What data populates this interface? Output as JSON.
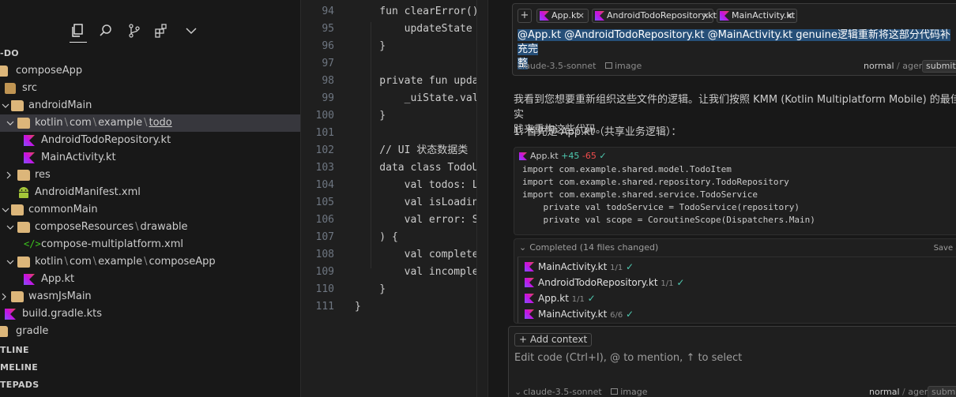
{
  "colors": {
    "accent": "#0078d4",
    "kotlin_a": "#7f52ff",
    "kotlin_b": "#e44857",
    "folder": "#dcb67a",
    "xml_green": "#3dc41e",
    "android_green": "#a4c639"
  },
  "explorer": {
    "toolbar_icons": [
      "files-icon",
      "search-icon",
      "source-control-icon",
      "extensions-icon",
      "chevron-down-icon"
    ],
    "root_label": "-DO",
    "tree": {
      "composeApp": "composeApp",
      "src": "src",
      "androidMain": "androidMain",
      "kotlin": "kotlin",
      "com": "com",
      "example": "example",
      "todo": "todo",
      "android_repo": "AndroidTodoRepository.kt",
      "main_activity": "MainActivity.kt",
      "res": "res",
      "manifest": "AndroidManifest.xml",
      "commonMain": "commonMain",
      "composeResources": "composeResources",
      "drawable": "drawable",
      "compose_xml": "compose-multiplatform.xml",
      "composeAppPkg": "composeApp",
      "app_kt": "App.kt",
      "wasmJsMain": "wasmJsMain",
      "build_gradle": "build.gradle.kts",
      "gradle": "gradle"
    },
    "path_sep": "\\",
    "sections": [
      "TLINE",
      "MELINE",
      "TEPADS"
    ]
  },
  "editor": {
    "lines": [
      {
        "n": "94",
        "code": "    fun clearError() {"
      },
      {
        "n": "95",
        "code": "        updateState { it"
      },
      {
        "n": "96",
        "code": "    }"
      },
      {
        "n": "97",
        "code": ""
      },
      {
        "n": "98",
        "code": "    private fun updateSt"
      },
      {
        "n": "99",
        "code": "        _uiState.value ="
      },
      {
        "n": "100",
        "code": "    }"
      },
      {
        "n": "101",
        "code": ""
      },
      {
        "n": "102",
        "code": "    // UI 状态数据类"
      },
      {
        "n": "103",
        "code": "    data class TodoUiSta"
      },
      {
        "n": "104",
        "code": "        val todos: List<"
      },
      {
        "n": "105",
        "code": "        val isLoading: B"
      },
      {
        "n": "106",
        "code": "        val error: Strin"
      },
      {
        "n": "107",
        "code": "    ) {"
      },
      {
        "n": "108",
        "code": "        val completedCou"
      },
      {
        "n": "109",
        "code": "        val incompleteCo"
      },
      {
        "n": "110",
        "code": "    }"
      },
      {
        "n": "111",
        "code": "}"
      }
    ]
  },
  "chat": {
    "context_chips": [
      {
        "label": "App.kt"
      },
      {
        "label": "AndroidTodoRepository.kt"
      },
      {
        "label": "MainActivity.kt"
      }
    ],
    "prompt_line1": "@App.kt  @AndroidTodoRepository.kt  @MainActivity.kt  genuine逻辑重新将这部分代码补充完",
    "prompt_line2": "整",
    "model": "claude-3.5-sonnet",
    "image_label": "image",
    "mode_normal": "normal",
    "mode_sep": "/",
    "mode_agent": "agent",
    "submit": "submit",
    "response_p1_line1": "我看到您想要重新组织这些文件的逻辑。让我们按照 KMM (Kotlin Multiplatform Mobile) 的最佳实",
    "response_p1_line2": "践来重构这些代码。",
    "response_p2": "1. 首先是 App.kt（共享业务逻辑）：",
    "code_block": {
      "file": "App.kt",
      "added": "+45",
      "removed": "-65",
      "check": "✓",
      "lines": [
        "import com.example.shared.model.TodoItem",
        "import com.example.shared.repository.TodoRepository",
        "import com.example.shared.service.TodoService",
        "    private val todoService = TodoService(repository)",
        "    private val scope = CoroutineScope(Dispatchers.Main)"
      ]
    },
    "completed": {
      "title": "Completed",
      "summary": "(14 files changed)",
      "save_all": "Save all",
      "items": [
        {
          "name": "MainActivity.kt",
          "meta": "1/1",
          "check": "✓"
        },
        {
          "name": "AndroidTodoRepository.kt",
          "meta": "1/1",
          "check": "✓"
        },
        {
          "name": "App.kt",
          "meta": "1/1",
          "check": "✓"
        },
        {
          "name": "MainActivity.kt",
          "meta": "6/6",
          "check": "✓"
        }
      ]
    },
    "bottom": {
      "add_context": "+ Add context",
      "placeholder": "Edit code (Ctrl+I), @ to mention, ↑ to select",
      "model": "claude-3.5-sonnet",
      "image_label": "image",
      "mode_normal": "normal",
      "mode_sep": "/",
      "mode_agent": "agent",
      "submit": "submit"
    }
  }
}
